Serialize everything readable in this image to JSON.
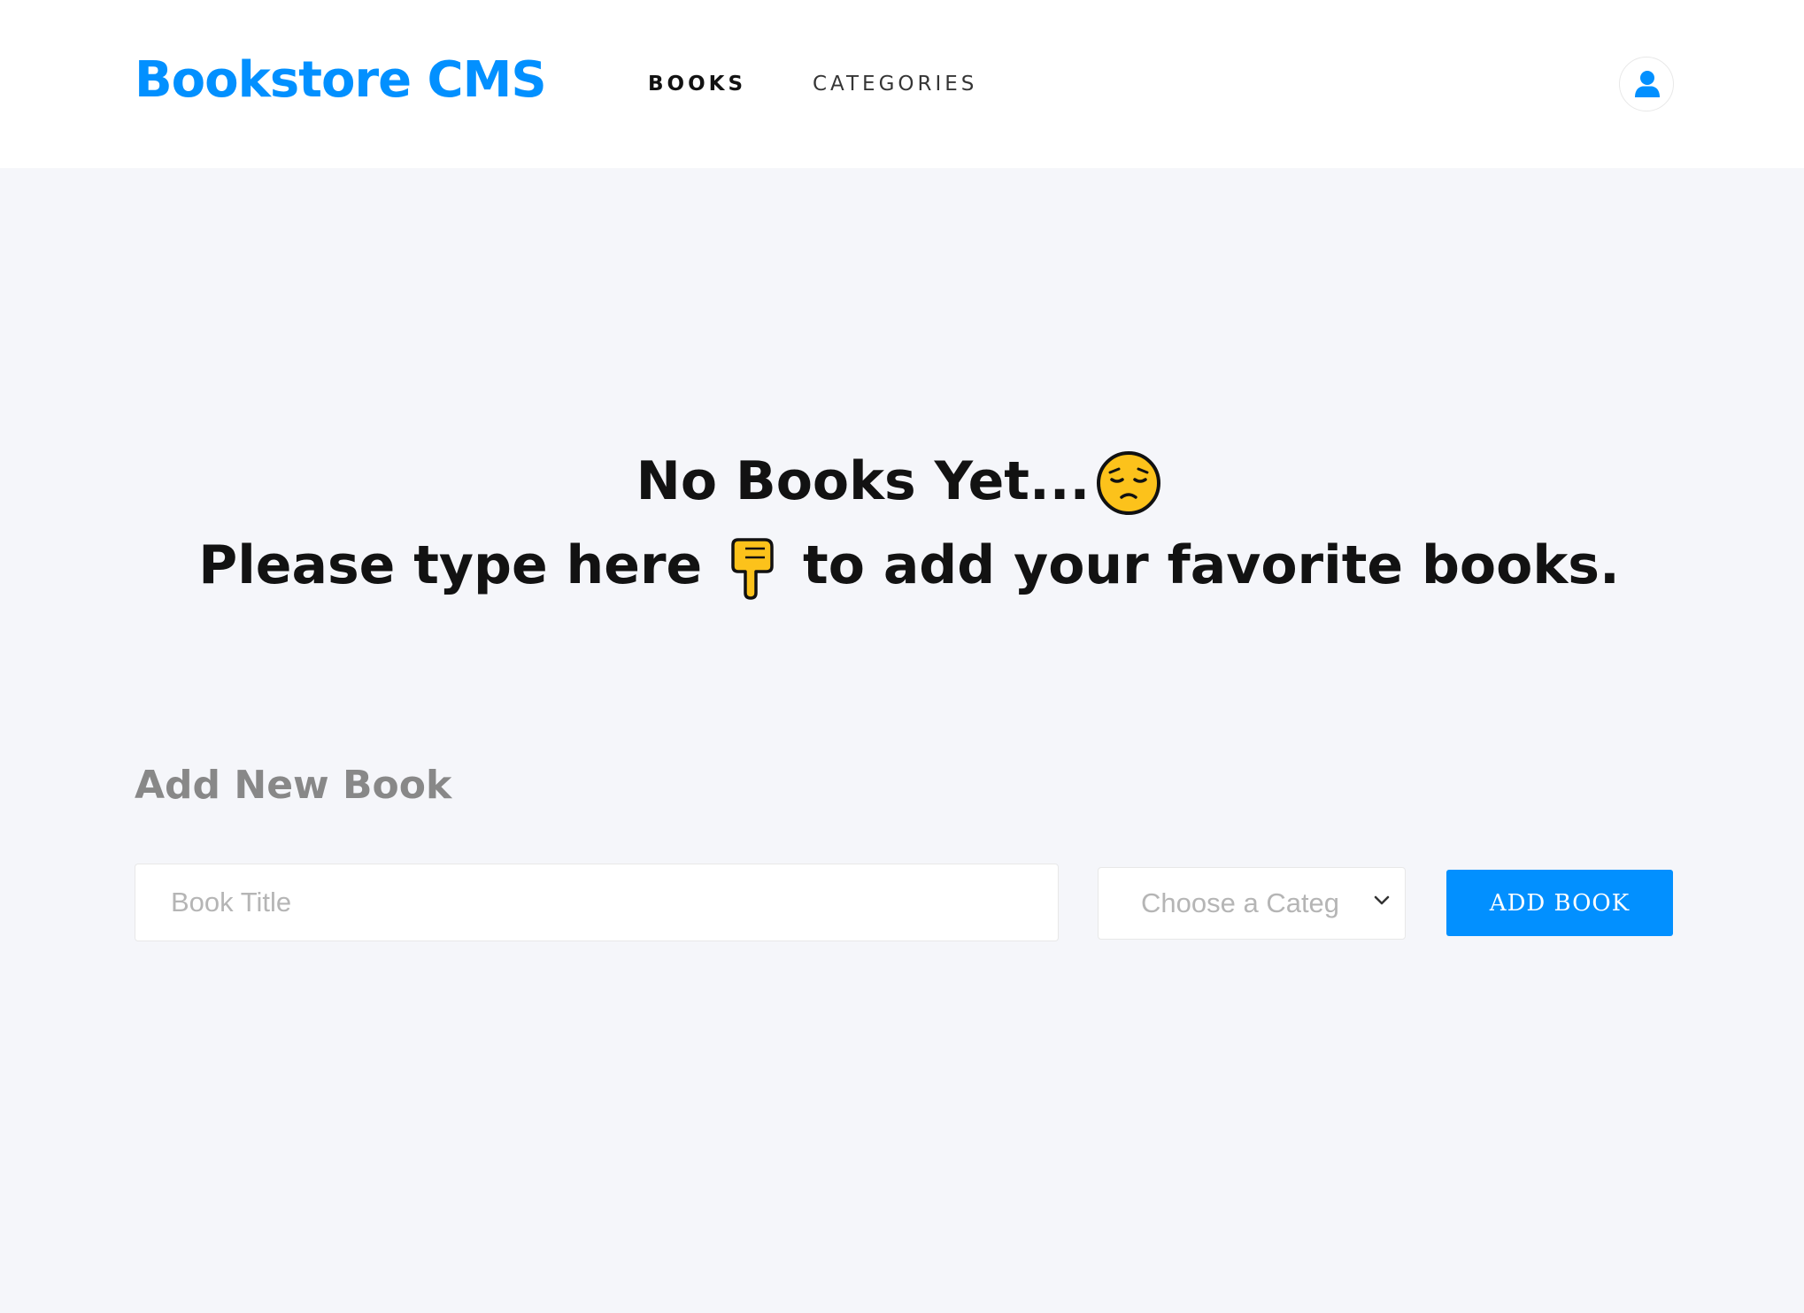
{
  "header": {
    "logo": "Bookstore CMS",
    "nav": {
      "books": "BOOKS",
      "categories": "CATEGORIES"
    },
    "user_icon": "user-icon"
  },
  "empty_state": {
    "line1_text": "No Books Yet...",
    "line1_emoji": "pensive-face-emoji",
    "line2_before": "Please type here",
    "line2_emoji": "pointing-down-hand-emoji",
    "line2_after": "to add your favorite books."
  },
  "form": {
    "title": "Add New Book",
    "title_placeholder": "Book Title",
    "category_placeholder": "Choose a Category",
    "submit_label": "ADD BOOK"
  },
  "colors": {
    "brand": "#0290ff",
    "background": "#f5f6fa",
    "text_dark": "#121212",
    "muted": "#888888"
  }
}
